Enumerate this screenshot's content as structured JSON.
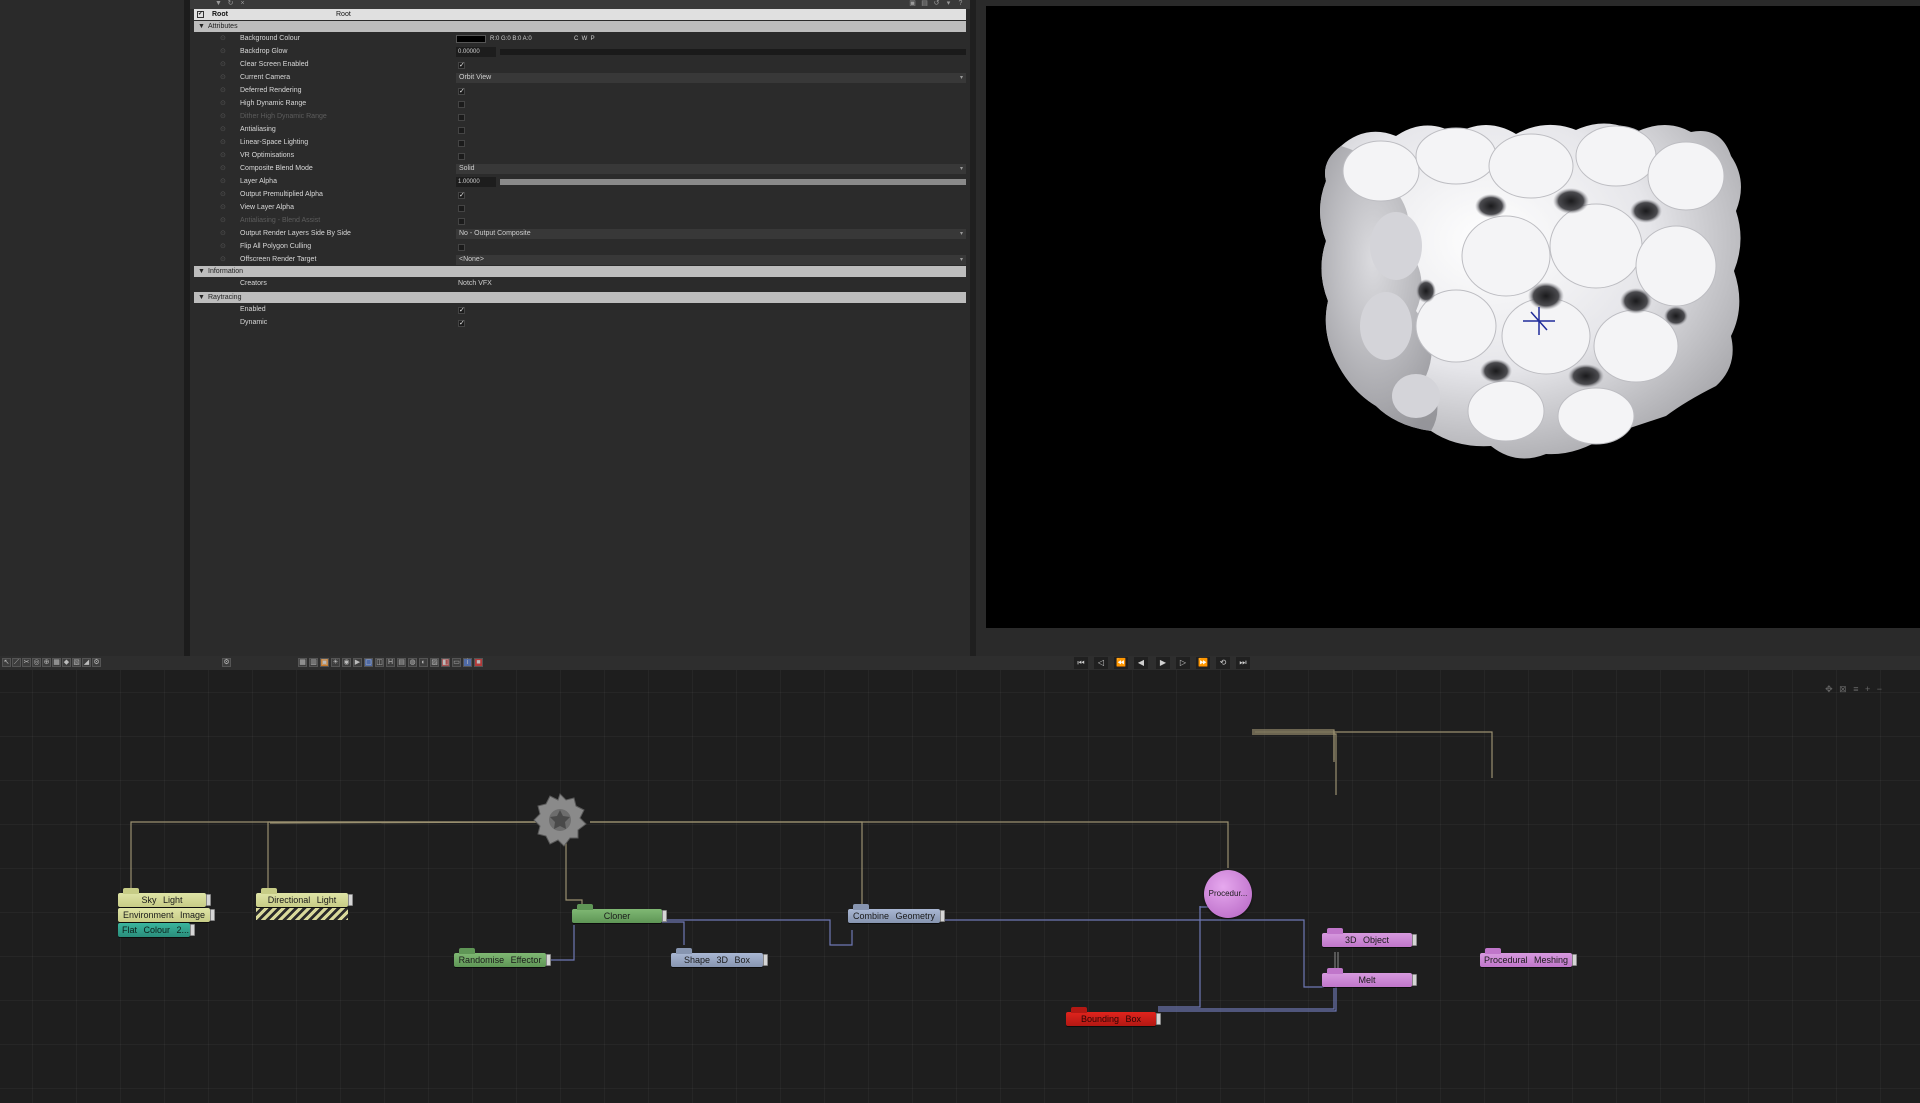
{
  "properties": {
    "root": {
      "name": "Root",
      "value": "Root"
    },
    "sections": {
      "attributes": "Attributes",
      "information": "Information",
      "raytracing": "Raytracing"
    },
    "attributes": [
      {
        "label": "Background Colour",
        "type": "colour",
        "value": "R:0 G:0 B:0 A:0",
        "extra": "C  W  P"
      },
      {
        "label": "Backdrop Glow",
        "type": "slider",
        "value": "0.00000",
        "fill": 0
      },
      {
        "label": "Clear Screen Enabled",
        "type": "check",
        "checked": true
      },
      {
        "label": "Current Camera",
        "type": "dropdown",
        "value": "Orbit View"
      },
      {
        "label": "Deferred Rendering",
        "type": "check",
        "checked": true
      },
      {
        "label": "High Dynamic Range",
        "type": "check",
        "checked": false
      },
      {
        "label": "Dither High Dynamic Range",
        "type": "check",
        "checked": false,
        "dim": true
      },
      {
        "label": "Antialiasing",
        "type": "check",
        "checked": false
      },
      {
        "label": "Linear-Space Lighting",
        "type": "check",
        "checked": false
      },
      {
        "label": "VR Optimisations",
        "type": "check",
        "checked": false
      },
      {
        "label": "Composite Blend Mode",
        "type": "dropdown",
        "value": "Solid"
      },
      {
        "label": "Layer Alpha",
        "type": "slider",
        "value": "1.00000",
        "fill": 1
      },
      {
        "label": "Output Premultiplied Alpha",
        "type": "check",
        "checked": true
      },
      {
        "label": "View Layer Alpha",
        "type": "check",
        "checked": false
      },
      {
        "label": "Antialiasing - Blend Assist",
        "type": "check",
        "checked": false,
        "dim": true
      },
      {
        "label": "Output Render Layers Side By Side",
        "type": "dropdown",
        "value": "No - Output Composite"
      },
      {
        "label": "Flip All Polygon Culling",
        "type": "check",
        "checked": false
      },
      {
        "label": "Offscreen Render Target",
        "type": "dropdown",
        "value": "<None>"
      }
    ],
    "information": [
      {
        "label": "Creators",
        "value": "Notch VFX"
      }
    ],
    "raytracing": [
      {
        "label": "Enabled",
        "checked": true
      },
      {
        "label": "Dynamic",
        "checked": true
      }
    ]
  },
  "nodes": {
    "sky_light": "Sky Light",
    "environment_image": "Environment Image",
    "flat_colour": "Flat Colour 2...",
    "directional_light": "Directional Light",
    "cloner": "Cloner",
    "randomise_effector": "Randomise Effector",
    "shape_3d_box": "Shape 3D Box",
    "combine_geometry": "Combine Geometry",
    "procedural": "Procedur...",
    "object_3d": "3D Object",
    "melt": "Melt",
    "procedural_meshing": "Procedural Meshing",
    "bounding_box": "Bounding Box"
  },
  "colors": {
    "node_yellow": "#d6db98",
    "node_teal": "#33a48f",
    "node_green": "#6fa865",
    "node_blue": "#98a6c2",
    "node_pink": "#cc88d5",
    "node_red": "#cc1e18",
    "viewport_bg": "#000000"
  },
  "icons": {
    "root_node": "gear-icon",
    "playback": [
      "skip-start-icon",
      "step-back-icon",
      "rewind-icon",
      "frame-back-icon",
      "play-icon",
      "frame-forward-icon",
      "fast-forward-icon",
      "loop-icon",
      "skip-end-icon"
    ]
  }
}
